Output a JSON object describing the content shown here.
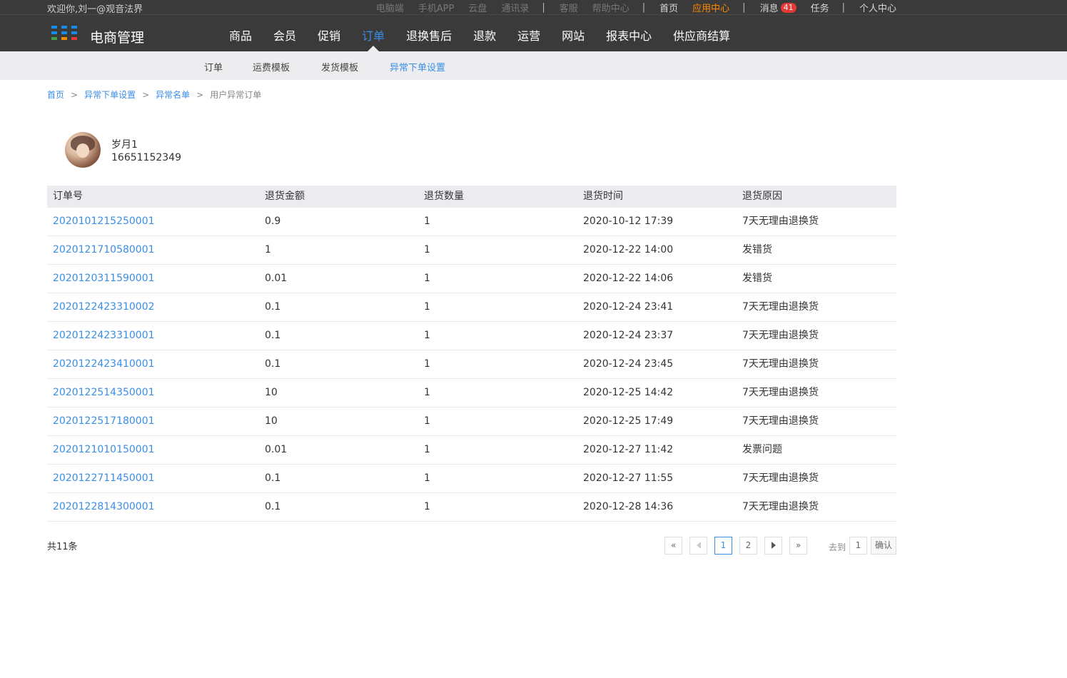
{
  "header": {
    "welcome": "欢迎你,刘一@观音法界",
    "top_links": [
      {
        "label": "电脑端",
        "style": "dim"
      },
      {
        "label": "手机APP",
        "style": "dim"
      },
      {
        "label": "云盘",
        "style": "dim"
      },
      {
        "label": "通讯录",
        "style": "dim"
      },
      {
        "sep": true
      },
      {
        "label": "客服",
        "style": "dim"
      },
      {
        "label": "帮助中心",
        "style": "dim"
      },
      {
        "sep": true
      },
      {
        "label": "首页",
        "style": "bright"
      },
      {
        "label": "应用中心",
        "style": "orange"
      },
      {
        "sep": true
      },
      {
        "label": "消息",
        "style": "bright",
        "badge": "41"
      },
      {
        "label": "任务",
        "style": "bright"
      },
      {
        "sep": true
      },
      {
        "label": "个人中心",
        "style": "bright"
      }
    ],
    "brand": "电商管理",
    "logo_colors": [
      "#1e88e5",
      "#43a047",
      "#fb8c00",
      "#e53935"
    ]
  },
  "main_nav": [
    {
      "label": "商品"
    },
    {
      "label": "会员"
    },
    {
      "label": "促销"
    },
    {
      "label": "订单",
      "active": true
    },
    {
      "label": "退换售后"
    },
    {
      "label": "退款"
    },
    {
      "label": "运营"
    },
    {
      "label": "网站"
    },
    {
      "label": "报表中心"
    },
    {
      "label": "供应商结算"
    }
  ],
  "sub_nav": [
    {
      "label": "订单"
    },
    {
      "label": "运费模板"
    },
    {
      "label": "发货模板"
    },
    {
      "label": "异常下单设置",
      "active": true
    }
  ],
  "breadcrumb": [
    "首页",
    "异常下单设置",
    "异常名单",
    "用户异常订单"
  ],
  "breadcrumb_sep": ">",
  "user": {
    "name": "岁月1",
    "phone": "16651152349"
  },
  "table": {
    "headers": [
      "订单号",
      "退货金额",
      "退货数量",
      "退货时间",
      "退货原因"
    ],
    "rows": [
      [
        "2020101215250001",
        "0.9",
        "1",
        "2020-10-12 17:39",
        "7天无理由退换货"
      ],
      [
        "2020121710580001",
        "1",
        "1",
        "2020-12-22 14:00",
        "发错货"
      ],
      [
        "2020120311590001",
        "0.01",
        "1",
        "2020-12-22 14:06",
        "发错货"
      ],
      [
        "2020122423310002",
        "0.1",
        "1",
        "2020-12-24 23:41",
        "7天无理由退换货"
      ],
      [
        "2020122423310001",
        "0.1",
        "1",
        "2020-12-24 23:37",
        "7天无理由退换货"
      ],
      [
        "2020122423410001",
        "0.1",
        "1",
        "2020-12-24 23:45",
        "7天无理由退换货"
      ],
      [
        "2020122514350001",
        "10",
        "1",
        "2020-12-25 14:42",
        "7天无理由退换货"
      ],
      [
        "2020122517180001",
        "10",
        "1",
        "2020-12-25 17:49",
        "7天无理由退换货"
      ],
      [
        "2020121010150001",
        "0.01",
        "1",
        "2020-12-27 11:42",
        "发票问题"
      ],
      [
        "2020122711450001",
        "0.1",
        "1",
        "2020-12-27 11:55",
        "7天无理由退换货"
      ],
      [
        "2020122814300001",
        "0.1",
        "1",
        "2020-12-28 14:36",
        "7天无理由退换货"
      ]
    ]
  },
  "pagination": {
    "total": "共11条",
    "first": "«",
    "last": "»",
    "pages": [
      "1",
      "2"
    ],
    "current": "1",
    "goto_label": "去到",
    "goto_value": "1",
    "confirm": "确认"
  },
  "colors": {
    "accent": "#3a8ee6",
    "header_bg": "#3a3a3a",
    "highlight": "#ff8a00",
    "badge": "#e53935"
  }
}
